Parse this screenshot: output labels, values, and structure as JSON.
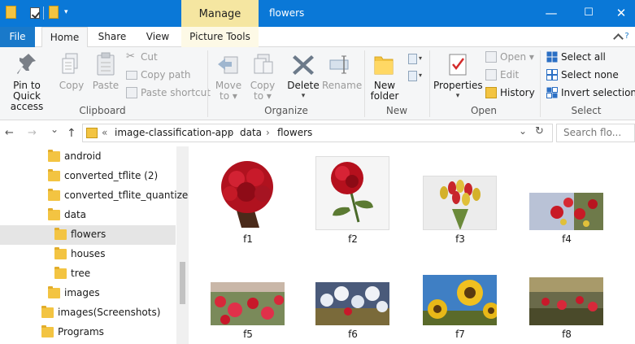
{
  "titlebar": {
    "context_tab": "Manage",
    "title": "flowers",
    "minimize": "—",
    "maximize": "☐",
    "close": "✕"
  },
  "tabs": {
    "file": "File",
    "home": "Home",
    "share": "Share",
    "view": "View",
    "picture_tools": "Picture Tools",
    "help": "?"
  },
  "ribbon": {
    "clipboard": {
      "pin_line1": "Pin to Quick",
      "pin_line2": "access",
      "copy": "Copy",
      "paste": "Paste",
      "cut": "Cut",
      "copy_path": "Copy path",
      "paste_shortcut": "Paste shortcut",
      "label": "Clipboard"
    },
    "organize": {
      "move_line1": "Move",
      "move_line2": "to ▾",
      "copy_line1": "Copy",
      "copy_line2": "to ▾",
      "delete": "Delete",
      "delete_arrow": "▾",
      "rename": "Rename",
      "label": "Organize"
    },
    "new": {
      "new_folder_line1": "New",
      "new_folder_line2": "folder",
      "label": "New"
    },
    "open": {
      "properties": "Properties",
      "properties_arrow": "▾",
      "open": "Open ▾",
      "edit": "Edit",
      "history": "History",
      "label": "Open"
    },
    "select": {
      "select_all": "Select all",
      "select_none": "Select none",
      "invert_selection": "Invert selection",
      "label": "Select"
    }
  },
  "address": {
    "back": "←",
    "forward": "→",
    "recent": "⌄",
    "up": "↑",
    "crumb_prefix": "«",
    "crumbs": [
      "image-classification-app",
      "data",
      "flowers"
    ],
    "sep": "›",
    "dropdown": "⌄",
    "refresh": "↻",
    "search_placeholder": "Search flo..."
  },
  "tree": {
    "items": [
      {
        "label": "android"
      },
      {
        "label": "converted_tflite (2)"
      },
      {
        "label": "converted_tflite_quantized"
      },
      {
        "label": "data"
      },
      {
        "label": "flowers"
      },
      {
        "label": "houses"
      },
      {
        "label": "tree"
      },
      {
        "label": "images"
      },
      {
        "label": "images(Screenshots)"
      },
      {
        "label": "Programs"
      }
    ]
  },
  "files": [
    {
      "name": "f1"
    },
    {
      "name": "f2"
    },
    {
      "name": "f3"
    },
    {
      "name": "f4"
    },
    {
      "name": "f5"
    },
    {
      "name": "f6"
    },
    {
      "name": "f7"
    },
    {
      "name": "f8"
    }
  ],
  "colors": {
    "titlebar": "#0a78d7",
    "manage_tab": "#f5e6a1",
    "folder": "#f3c442",
    "selection": "#e5e5e5"
  }
}
